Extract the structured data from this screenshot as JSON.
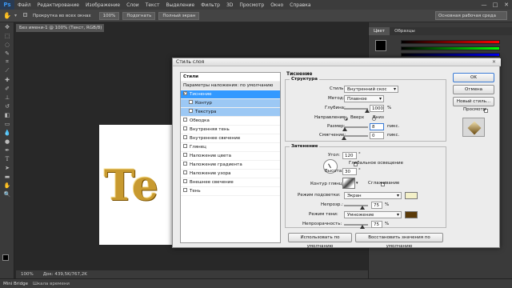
{
  "app": {
    "logo": "Ps",
    "menu": [
      "Файл",
      "Редактирование",
      "Изображение",
      "Слои",
      "Текст",
      "Выделение",
      "Фильтр",
      "3D",
      "Просмотр",
      "Окно",
      "Справка"
    ],
    "window_buttons": [
      "—",
      "□",
      "✕"
    ]
  },
  "options_bar": {
    "scroll_all_label": "Прокрутка во всех окнах",
    "zoom_btn": "100%",
    "fit_btn": "Подогнать",
    "full_btn": "Полный экран",
    "workspace": "Основная рабочая среда"
  },
  "document": {
    "tab_title": "Без имени-1 @ 100% (Текст, RGB/8) *",
    "canvas_text": "Te",
    "zoom": "100%",
    "doc_size": "Док: 439,5K/767,2K"
  },
  "bottom_bar": {
    "mini_bridge": "Mini Bridge",
    "timeline": "Шкала времени"
  },
  "right_panel": {
    "tab_color": "Цвет",
    "tab_swatches": "Образцы"
  },
  "dialog": {
    "title": "Стиль слоя",
    "close": "✕",
    "styles_header": "Стили",
    "styles": [
      {
        "label": "Параметры наложения: по умолчанию",
        "kind": "header",
        "checked": false
      },
      {
        "label": "Тиснение",
        "kind": "selected",
        "checked": true
      },
      {
        "label": "Контур",
        "kind": "sub",
        "checked": false
      },
      {
        "label": "Текстура",
        "kind": "sub",
        "checked": false
      },
      {
        "label": "Обводка",
        "kind": "normal",
        "checked": false
      },
      {
        "label": "Внутренняя тень",
        "kind": "normal",
        "checked": false
      },
      {
        "label": "Внутреннее свечение",
        "kind": "normal",
        "checked": false
      },
      {
        "label": "Глянец",
        "kind": "normal",
        "checked": false
      },
      {
        "label": "Наложение цвета",
        "kind": "normal",
        "checked": false
      },
      {
        "label": "Наложение градиента",
        "kind": "normal",
        "checked": false
      },
      {
        "label": "Наложение узора",
        "kind": "normal",
        "checked": false
      },
      {
        "label": "Внешнее свечение",
        "kind": "normal",
        "checked": false
      },
      {
        "label": "Тень",
        "kind": "normal",
        "checked": false
      }
    ],
    "bevel": {
      "section_title": "Тиснение",
      "structure_title": "Структура",
      "style_label": "Стиль:",
      "style_value": "Внутренний скос",
      "method_label": "Метод:",
      "method_value": "Плавное",
      "depth_label": "Глубина:",
      "depth_value": "1000",
      "depth_unit": "%",
      "depth_fraction": 0.95,
      "direction_label": "Направление:",
      "dir_up": "Вверх",
      "dir_down": "Вниз",
      "dir_up_selected": true,
      "size_label": "Размер:",
      "size_value": "8",
      "size_unit": "пикс.",
      "size_fraction": 0.04,
      "soften_label": "Смягчение:",
      "soften_value": "0",
      "soften_unit": "пикс.",
      "soften_fraction": 0.0
    },
    "shading": {
      "title": "Затенение",
      "angle_label": "Угол:",
      "angle_value": "120",
      "angle_unit": "°",
      "global_light": "Глобальное освещение",
      "global_light_checked": true,
      "altitude_label": "Высота:",
      "altitude_value": "30",
      "altitude_unit": "°",
      "gloss_label": "Контур глянца:",
      "antialias": "Сглаживание",
      "antialias_checked": false,
      "highlight_mode_label": "Режим подсветки:",
      "highlight_mode_value": "Экран",
      "highlight_color": "#f3f0c8",
      "h_opacity_label": "Непрозр.:",
      "h_opacity_value": "75",
      "h_opacity_unit": "%",
      "h_opacity_fraction": 0.75,
      "shadow_mode_label": "Режим тени:",
      "shadow_mode_value": "Умножение",
      "shadow_color": "#5a3a08",
      "s_opacity_label": "Непрозрачность:",
      "s_opacity_value": "75",
      "s_opacity_unit": "%",
      "s_opacity_fraction": 0.75
    },
    "buttons": {
      "make_default": "Использовать по умолчанию",
      "reset_default": "Восстановить значения по умолчанию",
      "ok": "OK",
      "cancel": "Отмена",
      "new_style": "Новый стиль...",
      "preview": "Просмотр",
      "preview_checked": true
    }
  }
}
